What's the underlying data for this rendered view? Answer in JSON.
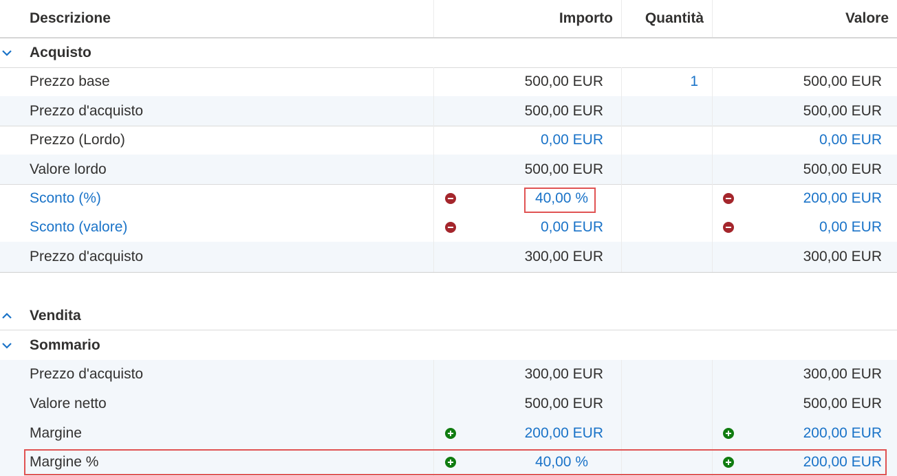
{
  "header": {
    "descrizione": "Descrizione",
    "importo": "Importo",
    "quantita": "Quantità",
    "valore": "Valore"
  },
  "acquisto": {
    "title": "Acquisto",
    "rows": [
      {
        "label": "Prezzo base",
        "importo": "500,00 EUR",
        "quantita": "1",
        "valore": "500,00 EUR"
      },
      {
        "label": "Prezzo d'acquisto",
        "importo": "500,00 EUR",
        "valore": "500,00 EUR"
      },
      {
        "label": "Prezzo (Lordo)",
        "importo": "0,00 EUR",
        "valore": "0,00 EUR"
      },
      {
        "label": "Valore lordo",
        "importo": "500,00 EUR",
        "valore": "500,00 EUR"
      },
      {
        "label": "Sconto (%)",
        "importo": "40,00 %",
        "valore": "200,00 EUR"
      },
      {
        "label": "Sconto (valore)",
        "importo": "0,00 EUR",
        "valore": "0,00 EUR"
      },
      {
        "label": "Prezzo d'acquisto",
        "importo": "300,00 EUR",
        "valore": "300,00 EUR"
      }
    ]
  },
  "vendita": {
    "title": "Vendita"
  },
  "sommario": {
    "title": "Sommario",
    "rows": [
      {
        "label": "Prezzo d'acquisto",
        "importo": "300,00 EUR",
        "valore": "300,00 EUR"
      },
      {
        "label": "Valore netto",
        "importo": "500,00 EUR",
        "valore": "500,00 EUR"
      },
      {
        "label": "Margine",
        "importo": "200,00 EUR",
        "valore": "200,00 EUR"
      },
      {
        "label": "Margine %",
        "importo": "40,00 %",
        "valore": "200,00 EUR"
      }
    ]
  },
  "icons": {
    "expanded": "chevron-down-icon",
    "collapsed": "chevron-up-icon",
    "remove": "minus-circle-icon",
    "add": "plus-circle-icon"
  },
  "colors": {
    "link": "#1a73c8",
    "remove": "#a4262c",
    "add": "#107c10",
    "highlight": "#e05252",
    "alt_row": "#f3f7fb"
  }
}
